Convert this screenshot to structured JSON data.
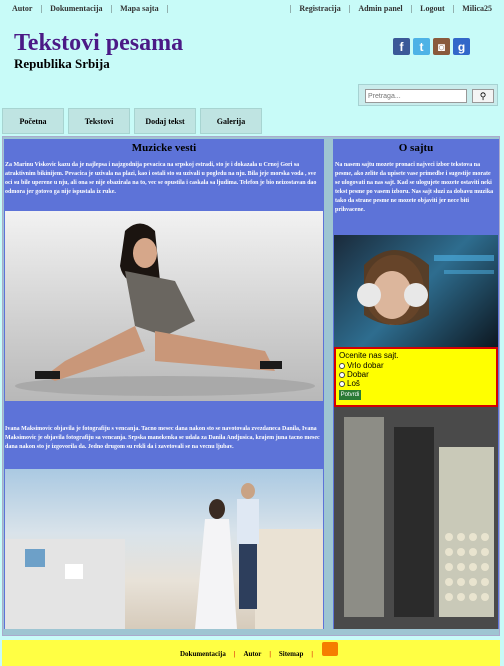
{
  "topbar": {
    "left_links": [
      "Autor",
      "Dokumentacija",
      "Mapa sajta"
    ],
    "right_links": [
      "Registracija",
      "Admin panel",
      "Logout",
      "Milica25"
    ]
  },
  "header": {
    "title": "Tekstovi pesama",
    "subtitle": "Republika Srbija",
    "social": [
      "facebook-icon",
      "twitter-icon",
      "instagram-icon",
      "google-plus-icon"
    ]
  },
  "search": {
    "placeholder": "Pretraga...",
    "button_icon": "search-icon"
  },
  "nav": [
    "Početna",
    "Tekstovi",
    "Dodaj tekst",
    "Galerija"
  ],
  "left": {
    "title": "Muzicke vesti",
    "news1": "Za Marinu Viskovic kazu da je najlepsa i najzgodnija pevacica na srpskoj estradi, sto je i dokazala u Crnoj Gori sa atraktivnim bikinijem. Pevacica je uzivala na plazi, kao i ostali sto su uzivali u pogledu na nju. Bila jeje morska voda , sve oci su bile uperene u nju, ali ona se nije obazirala na to, vec se opustila i caskala sa ljudima. Telefon je bio neizostavan dao odmora jer gotovo ga nije ispustala iz ruke.",
    "news2": "Ivana Maksimovic objavila je fotografiju s vencanja. Tacno mesec dana nakon sto se navotovala zvezdaneca Danila, Ivana Maksimovic je objavila fotografiju sa vencanja. Srpska manekenka se udala za Danila Andjusica, krajem juna tacno mesec dana nakon sto je izgovorila da. Jedno drugom su rekli da i zavetovali se na vecnu ljubav."
  },
  "right": {
    "title": "O sajtu",
    "about": "Na nasem sajtu mozete pronaci najveci izbor tekstova na pesme, ako zelite da upisete vase primedbe i sugestije morate se ulogovati na nas sajt. Kad se ulogujete mozete ostaviti neki tekst pesme po vasem izboru. Nas sajt sluzi za dobavu muzika tako da strane pesme ne mozete objaviti jer nece biti prihvacene."
  },
  "poll": {
    "question": "Ocenite nas sajt.",
    "options": [
      "Vrlo dobar",
      "Dobar",
      "Loš"
    ],
    "vote": "Potvrdi"
  },
  "footer": {
    "links": [
      "Dokumentacija",
      "Autor",
      "Sitemap"
    ]
  },
  "colors": {
    "background": "#c8fbf8",
    "title": "#4b1a86",
    "column": "#5d73d8",
    "poll": "#ffff00",
    "footer": "#ffff44"
  }
}
